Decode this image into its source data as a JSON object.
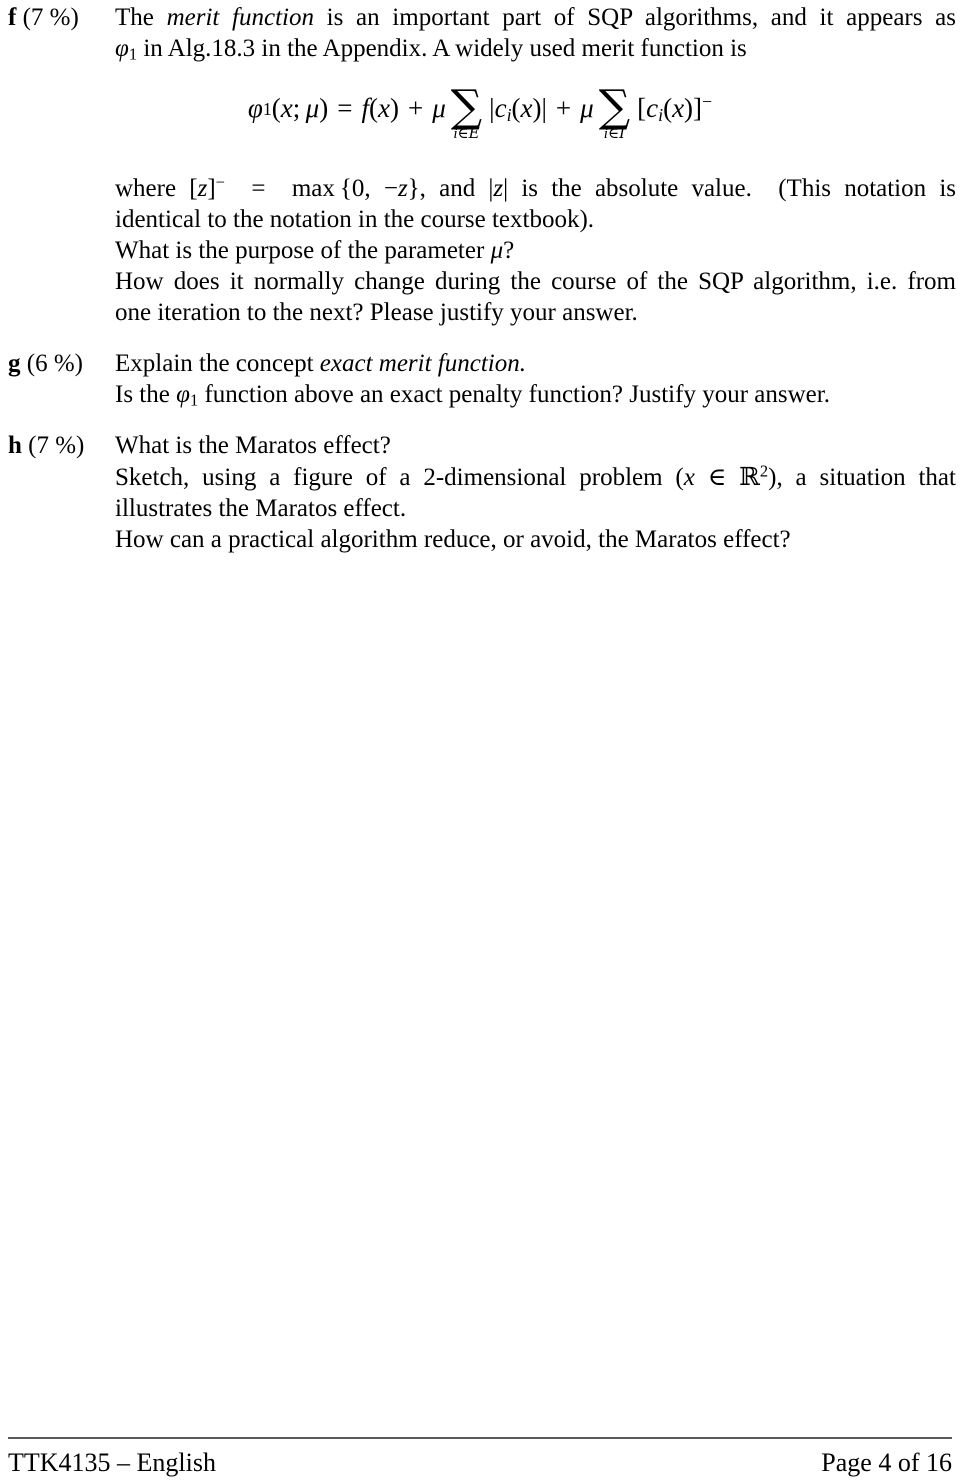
{
  "document": {
    "type": "exam-question-page",
    "course_code": "TTK4135",
    "language": "English"
  },
  "questions": [
    {
      "id": "f",
      "letter": "f",
      "points": "(7 %)",
      "lines": [
        "The merit function is an important part of SQP algorithms, and it appears as",
        "φ1 in Alg.18.3 in the Appendix. A widely used merit function is"
      ]
    },
    {
      "id": "g",
      "letter": "g",
      "points": "(6 %)",
      "lines": [
        "Explain the concept exact merit function.",
        "Is the φ1 function above an exact penalty function? Justify your answer."
      ]
    },
    {
      "id": "h",
      "letter": "h",
      "points": "(7 %)",
      "lines": [
        "What is the Maratos effect?",
        "Sketch, using a figure of a 2-dimensional problem (x ∈ ℝ2), a situation that",
        "illustrates the Maratos effect.",
        "How can a practical algorithm reduce, or avoid, the Maratos effect?"
      ]
    }
  ],
  "equation": {
    "latex": "\\phi_1(x;\\mu) = f(x) + \\mu \\sum_{i\\in\\mathcal{E}} |c_i(x)| + \\mu \\sum_{i\\in\\mathcal{I}} [c_i(x)]^-",
    "plain": "φ1(x;μ) = f(x) + μ ∑_{i∈E} |ci(x)| + μ ∑_{i∈I} [ci(x)]−",
    "lhs_fn": "φ",
    "lhs_sub": "1",
    "lhs_args": "(x; μ)",
    "eq_sign": "=",
    "term_f": "f(x)",
    "plus1": "+",
    "mu1": "μ",
    "sum1_glyph": "∑",
    "sum1_sub_i": "i",
    "sum1_sub_in": "∈",
    "sum1_sub_set": "E",
    "term_abs": "|ci(x)|",
    "plus2": "+",
    "mu2": "μ",
    "sum2_glyph": "∑",
    "sum2_sub_i": "i",
    "sum2_sub_in": "∈",
    "sum2_sub_set": "I",
    "term_neg": "[ci(x)]−",
    "neg_sup": "−"
  },
  "f_continuation": {
    "line1_a": "where [z]",
    "line1_sup": "−",
    "line1_b": "= max {0, −z}, and |z| is the absolute value. (This notation is",
    "line2": "identical to the notation in the course textbook).",
    "line3": "What is the purpose of the parameter μ?",
    "line4": "How does it normally change during the course of the SQP algorithm, i.e. from",
    "line5": "one iteration to the next? Please justify your answer."
  },
  "footer": {
    "left": "TTK4135 – English",
    "right": "Page 4 of 16",
    "rule_color": "#595959"
  },
  "f_text": {
    "l1_before": "The ",
    "l1_italic": "merit function",
    "l1_after": " is an important part of SQP algorithms, and it appears as",
    "l2_phi": "φ",
    "l2_sub": "1",
    "l2_rest": " in Alg.18.3 in the Appendix. A widely used merit function is"
  },
  "g_text": {
    "l1_before": "Explain the concept ",
    "l1_italic": "exact merit function.",
    "l2_a": "Is the ",
    "l2_phi": "φ",
    "l2_sub": "1",
    "l2_b": " function above an exact penalty function? Justify your answer."
  },
  "h_text": {
    "l1": "What is the Maratos effect?",
    "l2_a": "Sketch, using a figure of a 2-dimensional problem (",
    "l2_x": "x",
    "l2_in": " ∈ ",
    "l2_R": "ℝ",
    "l2_sup": "2",
    "l2_b": "), a situation that",
    "l3": "illustrates the Maratos effect.",
    "l4": "How can a practical algorithm reduce, or avoid, the Maratos effect?"
  }
}
